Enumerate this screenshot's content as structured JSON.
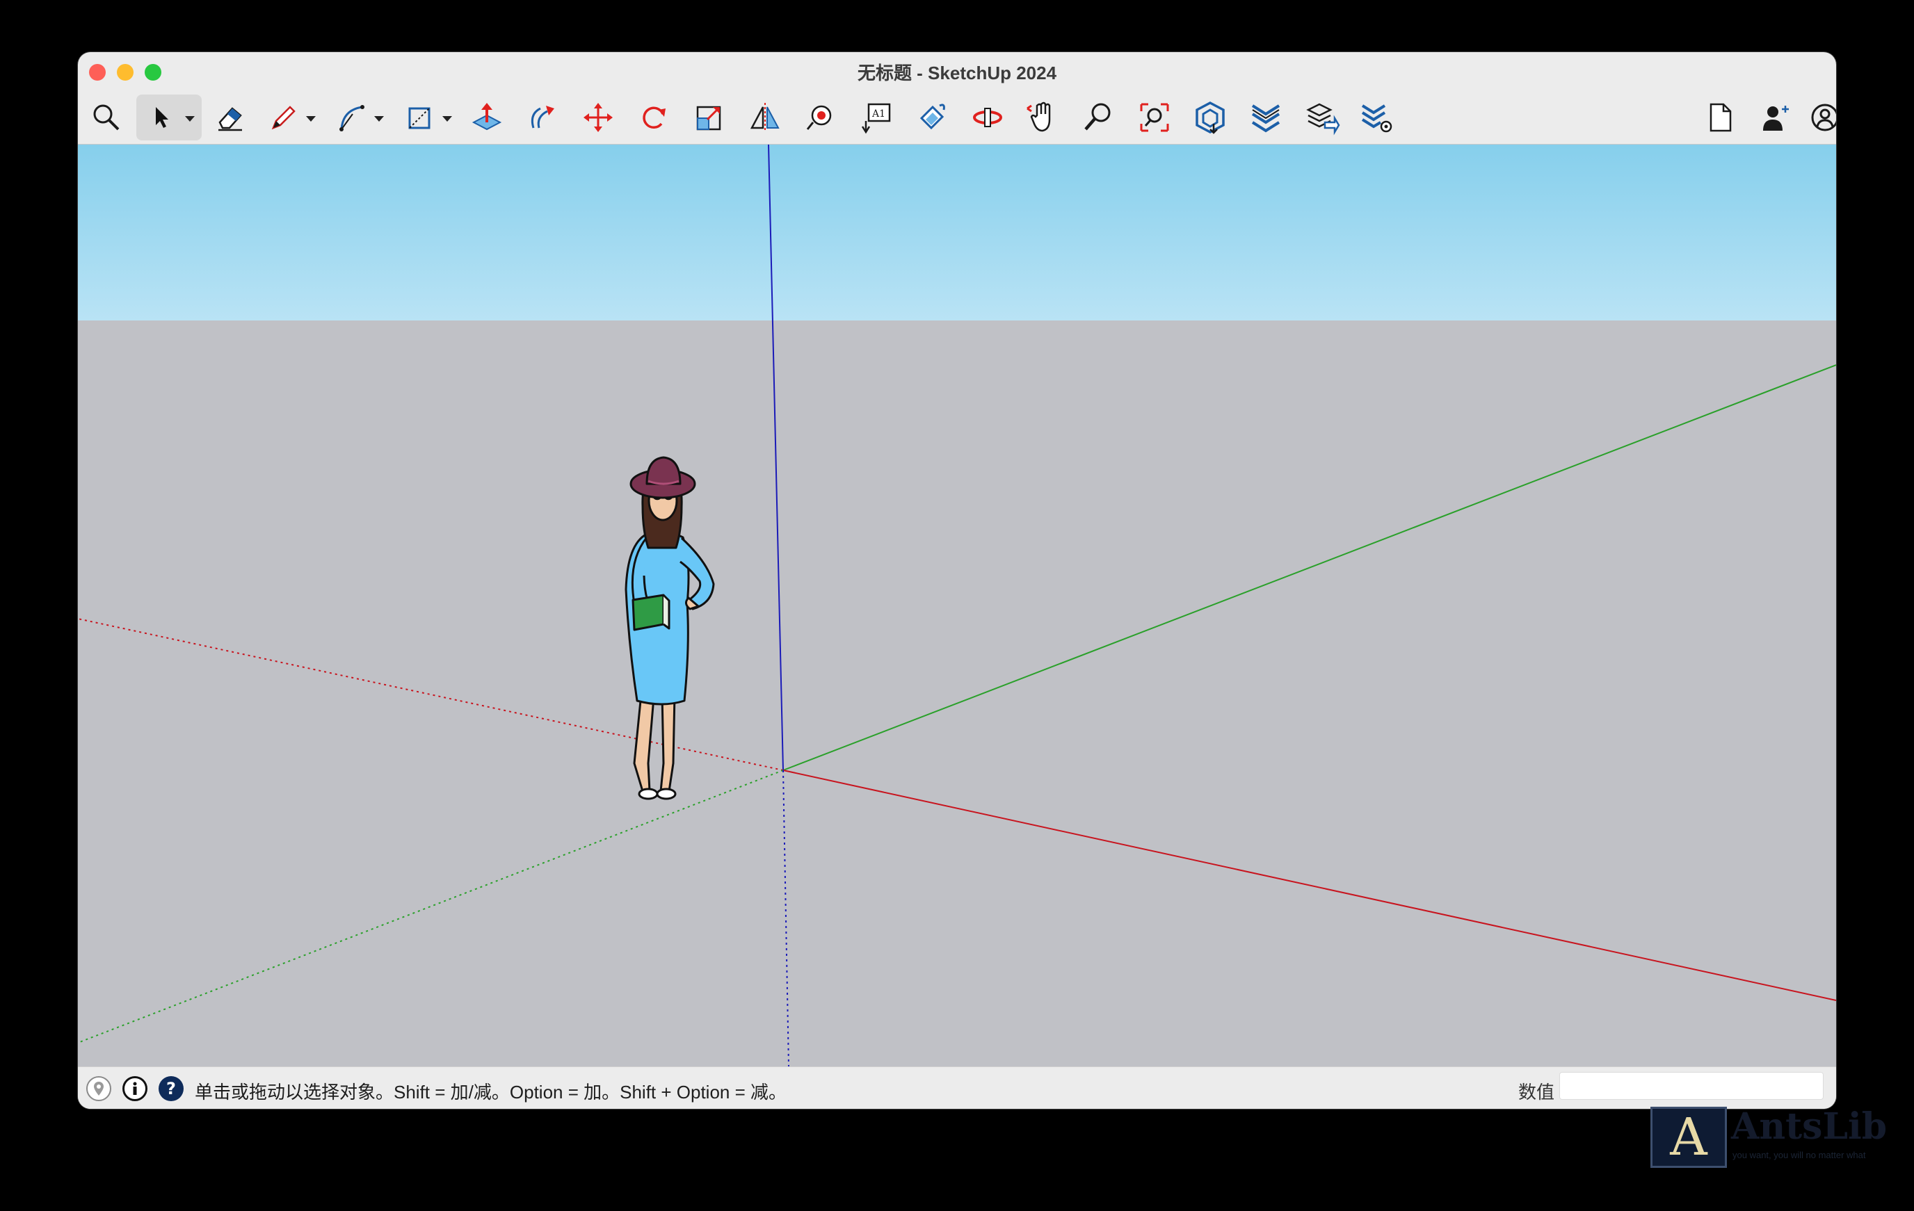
{
  "window": {
    "title": "无标题 - SketchUp 2024"
  },
  "toolbar": {
    "tools": [
      "search-icon",
      "select-icon",
      "eraser-icon",
      "pencil-icon",
      "arc-icon",
      "rectangle-icon",
      "push-pull-icon",
      "follow-me-icon",
      "move-icon",
      "rotate-icon",
      "scale-icon",
      "flip-icon",
      "paint-bucket-icon",
      "text-icon",
      "orbit-icon",
      "section-plane-icon",
      "pan-icon",
      "zoom-icon",
      "zoom-extents-icon",
      "3d-warehouse-icon",
      "extension-warehouse-icon",
      "layout-icon",
      "extension-manager-icon",
      "new-document-icon",
      "account-icon",
      "profile-icon"
    ]
  },
  "status": {
    "hint": "单击或拖动以选择对象。Shift = 加/减。Option = 加。Shift + Option = 减。",
    "measure_label": "数值",
    "measure_value": ""
  },
  "watermark": {
    "text": "AntsLib",
    "sub": "you want, you will no matter what",
    "logo": "A"
  },
  "colors": {
    "sky_top": "#86cfec",
    "sky_bottom": "#b9e3f5",
    "ground": "#c0c1c6",
    "axis_red": "#c8141e",
    "axis_green": "#2aa02a",
    "axis_blue": "#1b1bb8",
    "icon_accent": "#e0211e",
    "icon_blue": "#1c5fa8"
  }
}
